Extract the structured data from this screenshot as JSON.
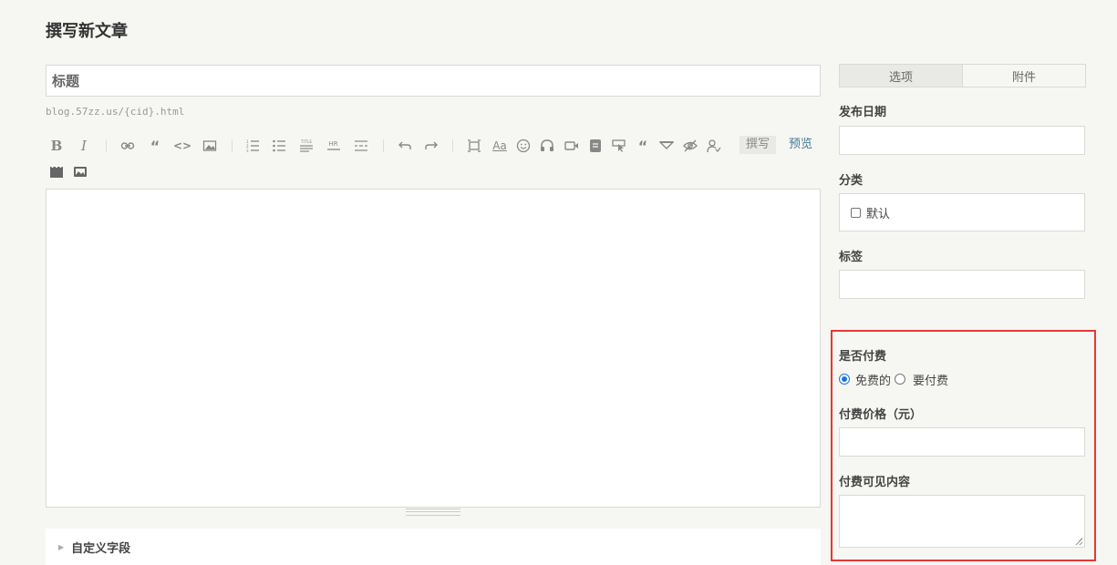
{
  "page": {
    "title": "撰写新文章"
  },
  "editor": {
    "title_placeholder": "标题",
    "url_hint": "blog.57zz.us/{cid}.html",
    "mode_write": "撰写",
    "mode_preview": "预览",
    "toolbar_icons": [
      "bold-icon",
      "italic-icon",
      "link-icon",
      "blockquote-icon",
      "code-icon",
      "image-icon",
      "ordered-list-icon",
      "unordered-list-icon",
      "title-icon",
      "hr-icon",
      "more-icon",
      "undo-icon",
      "redo-icon",
      "fullscreen-icon",
      "font-icon",
      "emoji-icon",
      "audio-icon",
      "video-icon",
      "card-icon",
      "button-icon",
      "quote-icon",
      "hide-icon",
      "eye-off-icon",
      "user-check-icon",
      "film-icon",
      "gallery-icon"
    ],
    "toolbar_text": {
      "bold": "B",
      "italic": "I",
      "quote": "“",
      "code": "<>",
      "font": "Aa"
    }
  },
  "custom_fields": {
    "label": "自定义字段"
  },
  "sidebar": {
    "tabs": [
      {
        "label": "选项"
      },
      {
        "label": "附件"
      }
    ],
    "publish_date_label": "发布日期",
    "category_label": "分类",
    "category_default": "默认",
    "tags_label": "标签",
    "paid_label": "是否付费",
    "paid_options": [
      {
        "label": "免费的",
        "checked": true
      },
      {
        "label": "要付费",
        "checked": false
      }
    ],
    "price_label": "付费价格（元）",
    "paid_content_label": "付费可见内容"
  },
  "colors": {
    "highlight": "#e53935",
    "accent": "#467b96",
    "radio": "#1a73e8"
  }
}
